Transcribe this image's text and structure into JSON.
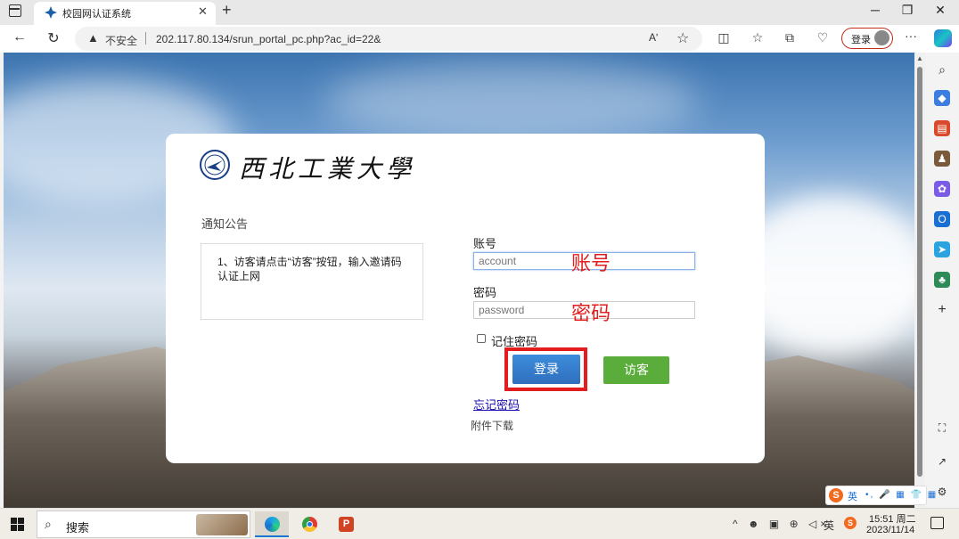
{
  "browser": {
    "tab_title": "校园网认证系统",
    "tab_close": "✕",
    "new_tab": "+",
    "window_controls": {
      "minimize": "─",
      "restore": "❐",
      "close": "✕"
    },
    "insecure_label": "不安全",
    "url": "202.117.80.134/srun_portal_pc.php?ac_id=22&",
    "read_aloud": "Aʹ",
    "signin_label": "登录",
    "more": "···"
  },
  "page": {
    "logo_text": "西北工業大學",
    "notice_title": "通知公告",
    "notice_text": "1、访客请点击“访客”按钮，输入邀请码认证上网",
    "account_label": "账号",
    "account_placeholder": "account",
    "account_annotation": "账号",
    "password_label": "密码",
    "password_placeholder": "password",
    "password_annotation": "密码",
    "remember_label": "记住密码",
    "login_button": "登录",
    "guest_button": "访客",
    "forgot_link": "忘记密码",
    "download_link": "附件下载",
    "accent_colors": {
      "login": "#2f6fbe",
      "guest": "#5aad3b",
      "annotation": "#e31d1d"
    }
  },
  "ime": {
    "logo": "S",
    "lang": "英",
    "icons": "•, 🎤 ▦ 👕 ▦"
  },
  "taskbar": {
    "search_label": "搜索",
    "ppt_letter": "P",
    "tray_icons": "^ ☻ ▣ ⊕ ◁×",
    "lang": "英",
    "sogou": "S",
    "time": "15:51 周二",
    "date": "2023/11/14"
  }
}
